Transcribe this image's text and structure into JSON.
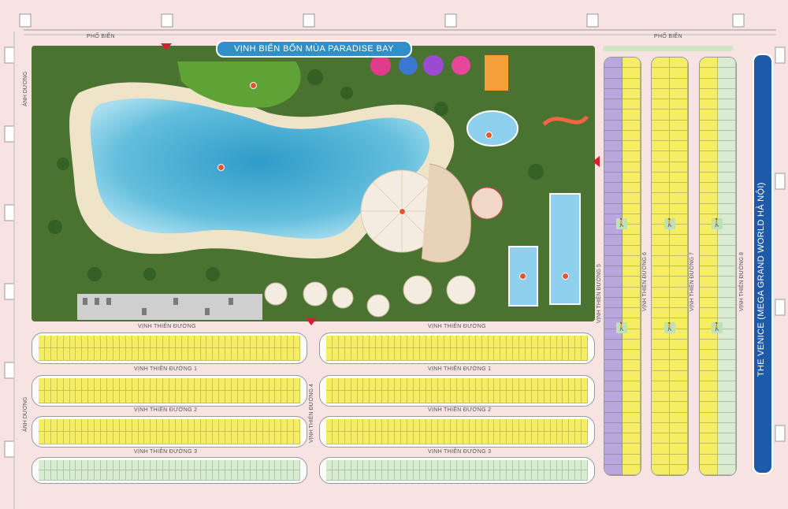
{
  "title_banner": "VỊNH BIỂN BỐN MÙA PARADISE BAY",
  "side_label": "THE VENICE (MEGA GRAND WORLD HÀ NỘI)",
  "roads": {
    "pho_bien_left": "PHỐ BIỂN",
    "pho_bien_right": "PHỐ BIỂN",
    "anh_duong_top": "ÁNH DƯƠNG",
    "anh_duong_bottom": "ÁNH DƯƠNG",
    "vinh_thien_duong": "VỊNH THIÊN ĐƯỜNG",
    "vinh_thien_duong_right": "VỊNH THIÊN ĐƯỜNG",
    "vtd1_left": "VỊNH THIÊN ĐƯỜNG 1",
    "vtd1_right": "VỊNH THIÊN ĐƯỜNG 1",
    "vtd2_left": "VỊNH THIÊN ĐƯỜNG 2",
    "vtd2_right": "VỊNH THIÊN ĐƯỜNG 2",
    "vtd3_left": "VỊNH THIÊN ĐƯỜNG 3",
    "vtd3_right": "VỊNH THIÊN ĐƯỜNG 3",
    "vtd4": "VỊNH THIÊN ĐƯỜNG 4",
    "vtd5": "VỊNH THIÊN ĐƯỜNG 5",
    "vtd6": "VỊNH THIÊN ĐƯỜNG 6",
    "vtd7": "VỊNH THIÊN ĐƯỜNG 7",
    "vtd8": "VỊNH THIÊN ĐƯỜNG 8"
  },
  "colors": {
    "lagoon": "#4fb3d6",
    "park_green": "#4d7a35",
    "plot_yellow": "#f5ee64",
    "plot_green": "#d9ecd2",
    "plot_purple": "#b8a6dd",
    "venice_blue": "#1f5aa8",
    "banner_blue": "#2f8fc9",
    "marker_red": "#d22030"
  },
  "icons": [
    "pedestrian-icon",
    "entrance-arrow-icon",
    "gazebo-icon",
    "amenity-marker-icon"
  ]
}
